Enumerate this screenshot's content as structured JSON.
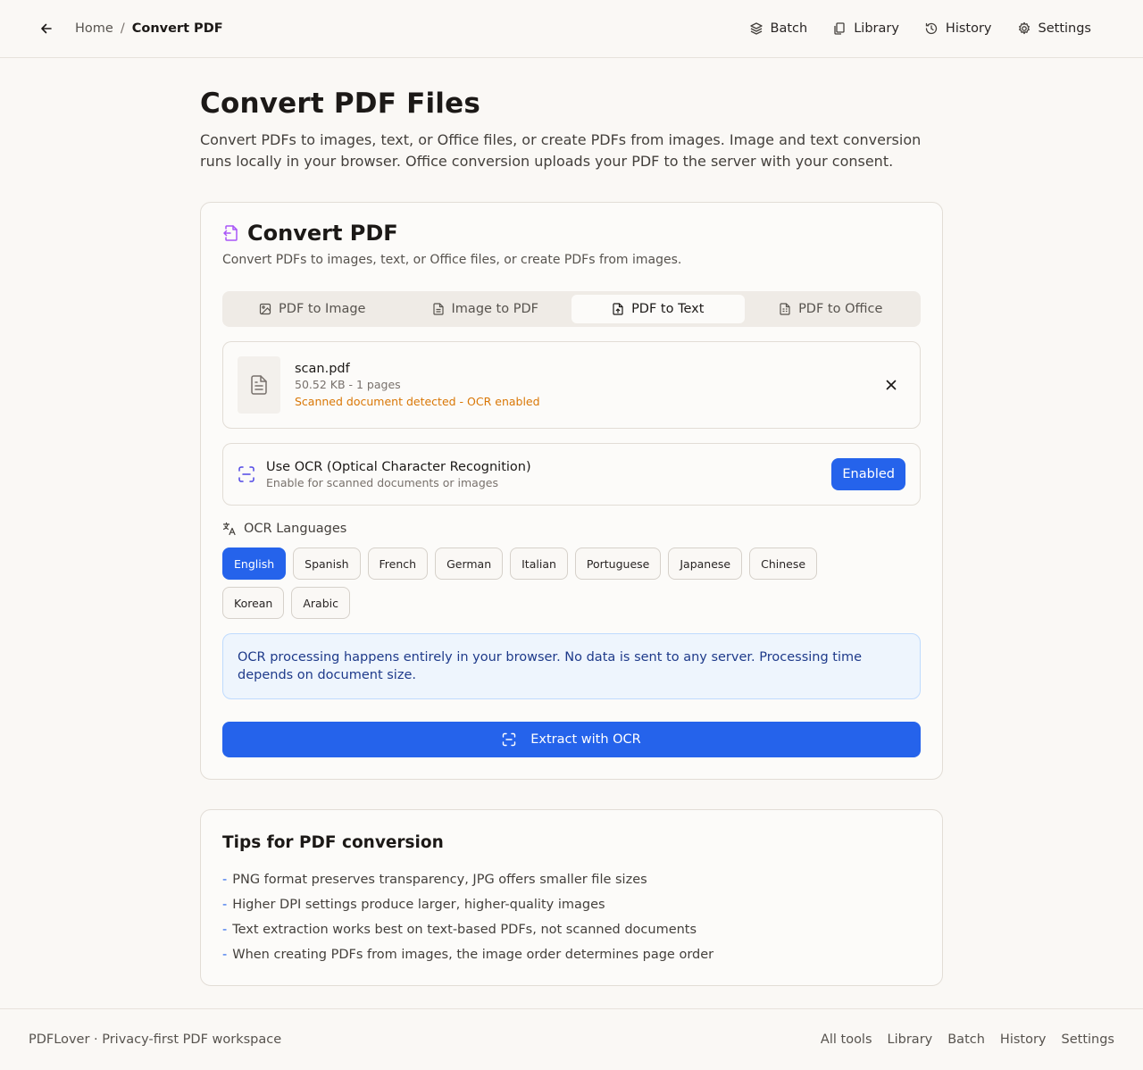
{
  "header": {
    "breadcrumb": {
      "home": "Home",
      "separator": "/",
      "current": "Convert PDF"
    },
    "nav": [
      {
        "label": "Batch",
        "icon": "layers-icon"
      },
      {
        "label": "Library",
        "icon": "copy-icon"
      },
      {
        "label": "History",
        "icon": "history-icon"
      },
      {
        "label": "Settings",
        "icon": "gear-icon"
      }
    ]
  },
  "page": {
    "title": "Convert PDF Files",
    "description": "Convert PDFs to images, text, or Office files, or create PDFs from images. Image and text conversion runs locally in your browser. Office conversion uploads your PDF to the server with your consent."
  },
  "card": {
    "title": "Convert PDF",
    "subtitle": "Convert PDFs to images, text, or Office files, or create PDFs from images.",
    "tabs": [
      {
        "label": "PDF to Image",
        "active": false
      },
      {
        "label": "Image to PDF",
        "active": false
      },
      {
        "label": "PDF to Text",
        "active": true
      },
      {
        "label": "PDF to Office",
        "active": false
      }
    ],
    "file": {
      "name": "scan.pdf",
      "meta": "50.52 KB - 1 pages",
      "notice": "Scanned document detected - OCR enabled"
    },
    "ocr": {
      "title": "Use OCR (Optical Character Recognition)",
      "subtitle": "Enable for scanned documents or images",
      "toggle_label": "Enabled"
    },
    "languages": {
      "heading": "OCR Languages",
      "options": [
        "English",
        "Spanish",
        "French",
        "German",
        "Italian",
        "Portuguese",
        "Japanese",
        "Chinese",
        "Korean",
        "Arabic"
      ],
      "selected": "English"
    },
    "info": "OCR processing happens entirely in your browser. No data is sent to any server. Processing time depends on document size.",
    "action_label": "Extract with OCR"
  },
  "tips": {
    "title": "Tips for PDF conversion",
    "bullet": "-",
    "items": [
      "PNG format preserves transparency, JPG offers smaller file sizes",
      "Higher DPI settings produce larger, higher-quality images",
      "Text extraction works best on text-based PDFs, not scanned documents",
      "When creating PDFs from images, the image order determines page order"
    ]
  },
  "footer": {
    "brand": "PDFLover · Privacy-first PDF workspace",
    "links": [
      "All tools",
      "Library",
      "Batch",
      "History",
      "Settings"
    ]
  },
  "colors": {
    "accent": "#2563eb",
    "background": "#faf8f5",
    "warning": "#d97706",
    "info_text": "#1e3a8a"
  }
}
